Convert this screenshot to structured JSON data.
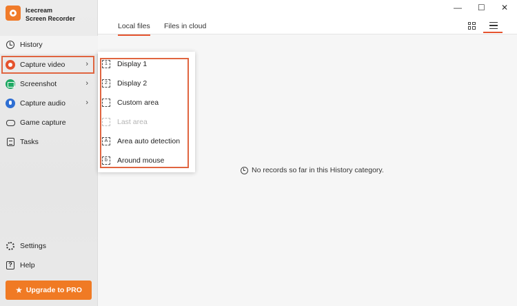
{
  "app": {
    "name_line1": "Icecream",
    "name_line2": "Screen Recorder"
  },
  "sidebar": {
    "items": [
      {
        "label": "History",
        "icon": "history-icon"
      },
      {
        "label": "Capture video",
        "icon": "record-icon"
      },
      {
        "label": "Screenshot",
        "icon": "camera-icon"
      },
      {
        "label": "Capture audio",
        "icon": "microphone-icon"
      },
      {
        "label": "Game capture",
        "icon": "gamepad-icon"
      },
      {
        "label": "Tasks",
        "icon": "tasks-icon"
      }
    ],
    "bottom": [
      {
        "label": "Settings",
        "icon": "gear-icon"
      },
      {
        "label": "Help",
        "icon": "help-icon"
      }
    ],
    "upgrade_label": "Upgrade to PRO"
  },
  "tabs": [
    {
      "label": "Local files",
      "active": true
    },
    {
      "label": "Files in cloud",
      "active": false
    }
  ],
  "window_controls": {
    "minimize": "—",
    "maximize": "☐",
    "close": "✕"
  },
  "empty_message": "No records so far in this History category.",
  "capture_menu": {
    "items": [
      {
        "label": "Display 1",
        "glyph": "1",
        "enabled": true
      },
      {
        "label": "Display 2",
        "glyph": "2",
        "enabled": true
      },
      {
        "label": "Custom area",
        "glyph": "",
        "enabled": true
      },
      {
        "label": "Last area",
        "glyph": "",
        "enabled": false
      },
      {
        "label": "Area auto detection",
        "glyph": "A",
        "enabled": true
      },
      {
        "label": "Around mouse",
        "glyph": "b",
        "enabled": true
      }
    ]
  },
  "colors": {
    "accent": "#e5532d",
    "upgrade": "#f07a24",
    "highlight": "#e0643f"
  }
}
